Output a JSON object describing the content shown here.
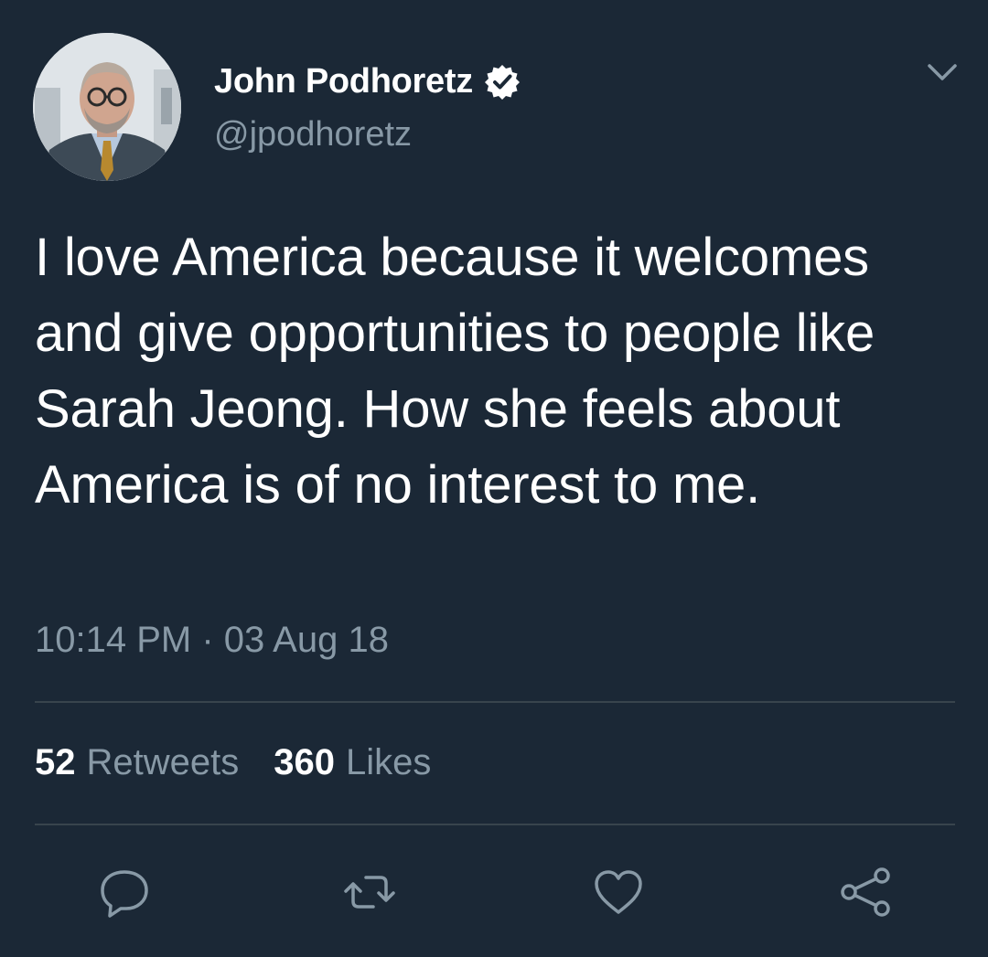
{
  "author": {
    "name": "John Podhoretz",
    "handle": "@jpodhoretz",
    "verified": true
  },
  "tweet": {
    "text": "I love America because it welcomes and give opportunities to people like Sarah Jeong. How she feels about America is of no interest to me.",
    "timestamp": "10:14 PM · 03 Aug 18"
  },
  "stats": {
    "retweets_count": "52",
    "retweets_label": "Retweets",
    "likes_count": "360",
    "likes_label": "Likes"
  },
  "actions": [
    "reply-icon",
    "retweet-icon",
    "like-icon",
    "share-icon"
  ],
  "colors": {
    "background": "#1b2836",
    "text_primary": "#ffffff",
    "text_secondary": "#8899a6",
    "divider": "#38444d",
    "icon": "#8899a6"
  }
}
